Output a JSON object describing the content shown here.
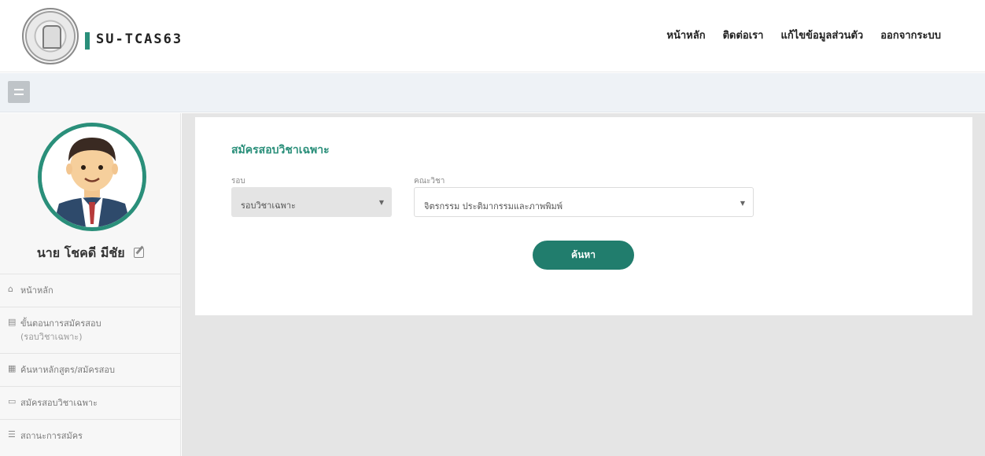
{
  "header": {
    "brand": "SU-TCAS63",
    "nav": [
      "หน้าหลัก",
      "ติดต่อเรา",
      "แก้ไขข้อมูลส่วนตัว",
      "ออกจากระบบ"
    ]
  },
  "sidebar": {
    "profile_name": "นาย โชคดี มีชัย",
    "items": [
      {
        "icon": "home-icon",
        "label": "หน้าหลัก",
        "sub": ""
      },
      {
        "icon": "document-icon",
        "label": "ขั้นตอนการสมัครสอบ",
        "sub": "(รอบวิชาเฉพาะ)"
      },
      {
        "icon": "course-icon",
        "label": "ค้นหาหลักสูตร/สมัครสอบ",
        "sub": ""
      },
      {
        "icon": "monitor-icon",
        "label": "สมัครสอบวิชาเฉพาะ",
        "sub": ""
      },
      {
        "icon": "list-icon",
        "label": "สถานะการสมัคร",
        "sub": ""
      }
    ]
  },
  "form": {
    "title": "สมัครสอบวิชาเฉพาะ",
    "round_label": "รอบ",
    "round_value": "รอบวิชาเฉพาะ",
    "faculty_label": "คณะวิชา",
    "faculty_value": "จิตรกรรม ประติมากรรมและภาพพิมพ์",
    "search_button": "ค้นหา"
  },
  "colors": {
    "accent": "#2a8f7a",
    "button": "#217d6d",
    "content_bg": "#e5e5e5",
    "strip_bg": "#eef2f6"
  }
}
